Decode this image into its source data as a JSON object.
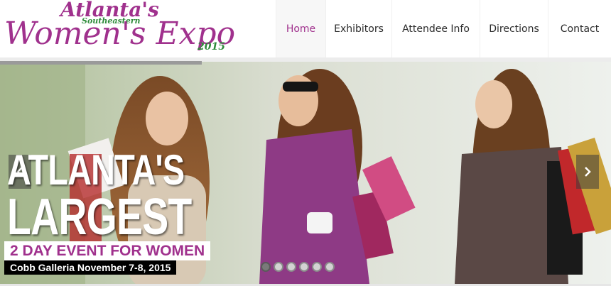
{
  "logo": {
    "line1": "Atlanta's",
    "line2": "Southeastern",
    "line3": "Women's Expo",
    "year": "2015",
    "colors": {
      "purple": "#a0318d",
      "green": "#2e8b3a"
    }
  },
  "nav": {
    "items": [
      {
        "label": "Home",
        "active": true
      },
      {
        "label": "Exhibitors",
        "active": false
      },
      {
        "label": "Attendee Info",
        "active": false
      },
      {
        "label": "Directions",
        "active": false
      },
      {
        "label": "Contact",
        "active": false
      }
    ]
  },
  "slider": {
    "progress": 0.33,
    "headline_1": "ATLANTA'S",
    "headline_2": "LARGEST",
    "tagline": "2 DAY EVENT FOR WOMEN",
    "subline": "Cobb Galleria November 7-8, 2015",
    "prev_icon": "chevron-left-icon",
    "next_icon": "chevron-right-icon",
    "slide_count": 6,
    "active_slide": 1
  }
}
